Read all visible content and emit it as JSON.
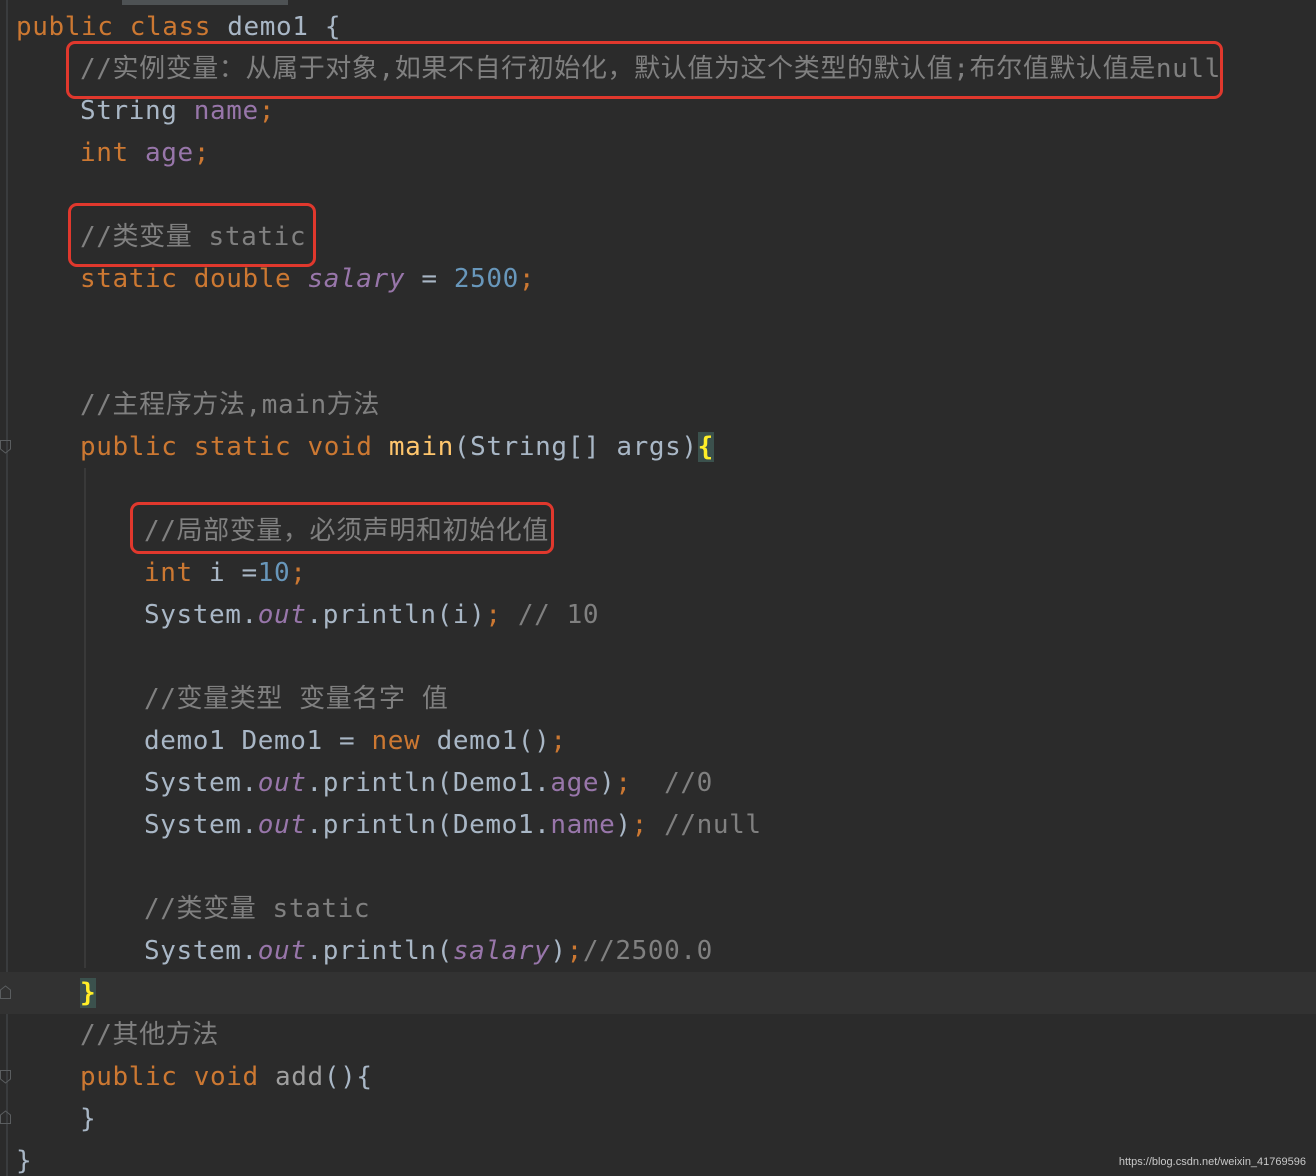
{
  "editor": {
    "colors": {
      "background": "#2b2b2b",
      "keyword": "#cc7832",
      "field": "#9876aa",
      "number": "#6897bb",
      "comment": "#808080",
      "method": "#ffc66d",
      "text": "#a9b7c6",
      "annotation_box": "#e0382d"
    },
    "lines": {
      "l1": {
        "kw": "public class ",
        "name": "demo1 ",
        "brace": "{"
      },
      "l2": {
        "comment": "//实例变量：从属于对象,如果不自行初始化，默认值为这个类型的默认值;布尔值默认值是null"
      },
      "l3": {
        "type": "String ",
        "field": "name",
        "semi": ";"
      },
      "l4": {
        "kw": "int ",
        "field": "age",
        "semi": ";"
      },
      "l5": {
        "comment": "//类变量 static"
      },
      "l6": {
        "kw": "static double ",
        "field": "salary",
        "op": " = ",
        "num": "2500",
        "semi": ";"
      },
      "l7": {
        "comment": "//主程序方法,main方法"
      },
      "l8": {
        "kw": "public static void ",
        "method": "main",
        "params": "(String[] args)",
        "brace": "{"
      },
      "l9": {
        "comment": "//局部变量，必须声明和初始化值"
      },
      "l10": {
        "kw": "int ",
        "var": "i =",
        "num": "10",
        "semi": ";"
      },
      "l11": {
        "obj": "System.",
        "field": "out",
        "call": ".println(i)",
        "semi": ";",
        "comment": " // 10"
      },
      "l12": {
        "comment": "//变量类型 变量名字 值"
      },
      "l13": {
        "decl": "demo1 Demo1 = ",
        "kw": "new",
        "call": " demo1()",
        "semi": ";"
      },
      "l14": {
        "obj": "System.",
        "field": "out",
        "call1": ".println(Demo1.",
        "field2": "age",
        "call2": ")",
        "semi": ";",
        "comment": "  //0"
      },
      "l15": {
        "obj": "System.",
        "field": "out",
        "call1": ".println(Demo1.",
        "field2": "name",
        "call2": ")",
        "semi": ";",
        "comment": " //null"
      },
      "l16": {
        "comment": "//类变量 static"
      },
      "l17": {
        "obj": "System.",
        "field": "out",
        "call1": ".println(",
        "field2": "salary",
        "call2": ")",
        "semi": ";",
        "comment": "//2500.0"
      },
      "l18": {
        "brace": "}"
      },
      "l19": {
        "comment": "//其他方法"
      },
      "l20": {
        "kw": "public void ",
        "method": "add",
        "rest": "(){"
      },
      "l21": {
        "brace": "}"
      },
      "l22": {
        "brace": "}"
      }
    }
  },
  "watermark": "https://blog.csdn.net/weixin_41769596"
}
